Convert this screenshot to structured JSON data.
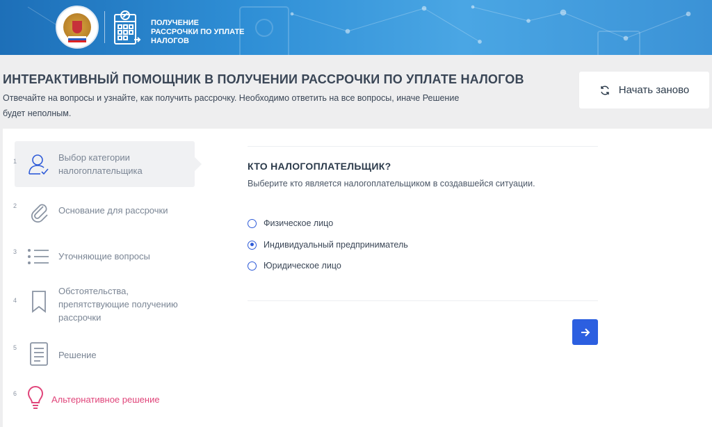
{
  "banner": {
    "service_title": "ПОЛУЧЕНИЕ РАССРОЧКИ ПО УПЛАТЕ НАЛОГОВ",
    "emblem_icon": "fns-emblem-icon",
    "service_icon": "calendar-percent-icon"
  },
  "header": {
    "title": "ИНТЕРАКТИВНЫЙ ПОМОЩНИК В ПОЛУЧЕНИИ РАССРОЧКИ ПО УПЛАТЕ НАЛОГОВ",
    "description": "Отвечайте на вопросы и узнайте, как получить рассрочку. Необходимо ответить на все вопросы, иначе Решение будет неполным.",
    "restart_label": "Начать заново",
    "restart_icon": "refresh-icon"
  },
  "steps": [
    {
      "num": "1",
      "label": "Выбор категории налогоплательщика",
      "icon": "user-check-icon",
      "active": true
    },
    {
      "num": "2",
      "label": "Основание для рассрочки",
      "icon": "paperclip-icon"
    },
    {
      "num": "3",
      "label": "Уточняющие вопросы",
      "icon": "list-icon"
    },
    {
      "num": "4",
      "label": "Обстоятельства, препятствующие получению рассрочки",
      "icon": "bookmark-icon"
    },
    {
      "num": "5",
      "label": "Решение",
      "icon": "document-icon"
    },
    {
      "num": "6",
      "label": "Альтернативное решение",
      "icon": "lightbulb-icon"
    }
  ],
  "question": {
    "title": "КТО НАЛОГОПЛАТЕЛЬЩИК?",
    "hint": "Выберите кто является налогоплательщиком в создавшейся ситуации.",
    "options": [
      {
        "label": "Физическое лицо",
        "selected": false
      },
      {
        "label": "Индивидуальный предприниматель",
        "selected": true
      },
      {
        "label": "Юридическое лицо",
        "selected": false
      }
    ],
    "next_icon": "arrow-right-icon"
  },
  "colors": {
    "accent": "#2c5fe0",
    "alt_step": "#e0457a",
    "banner": "#2f8fd6"
  }
}
